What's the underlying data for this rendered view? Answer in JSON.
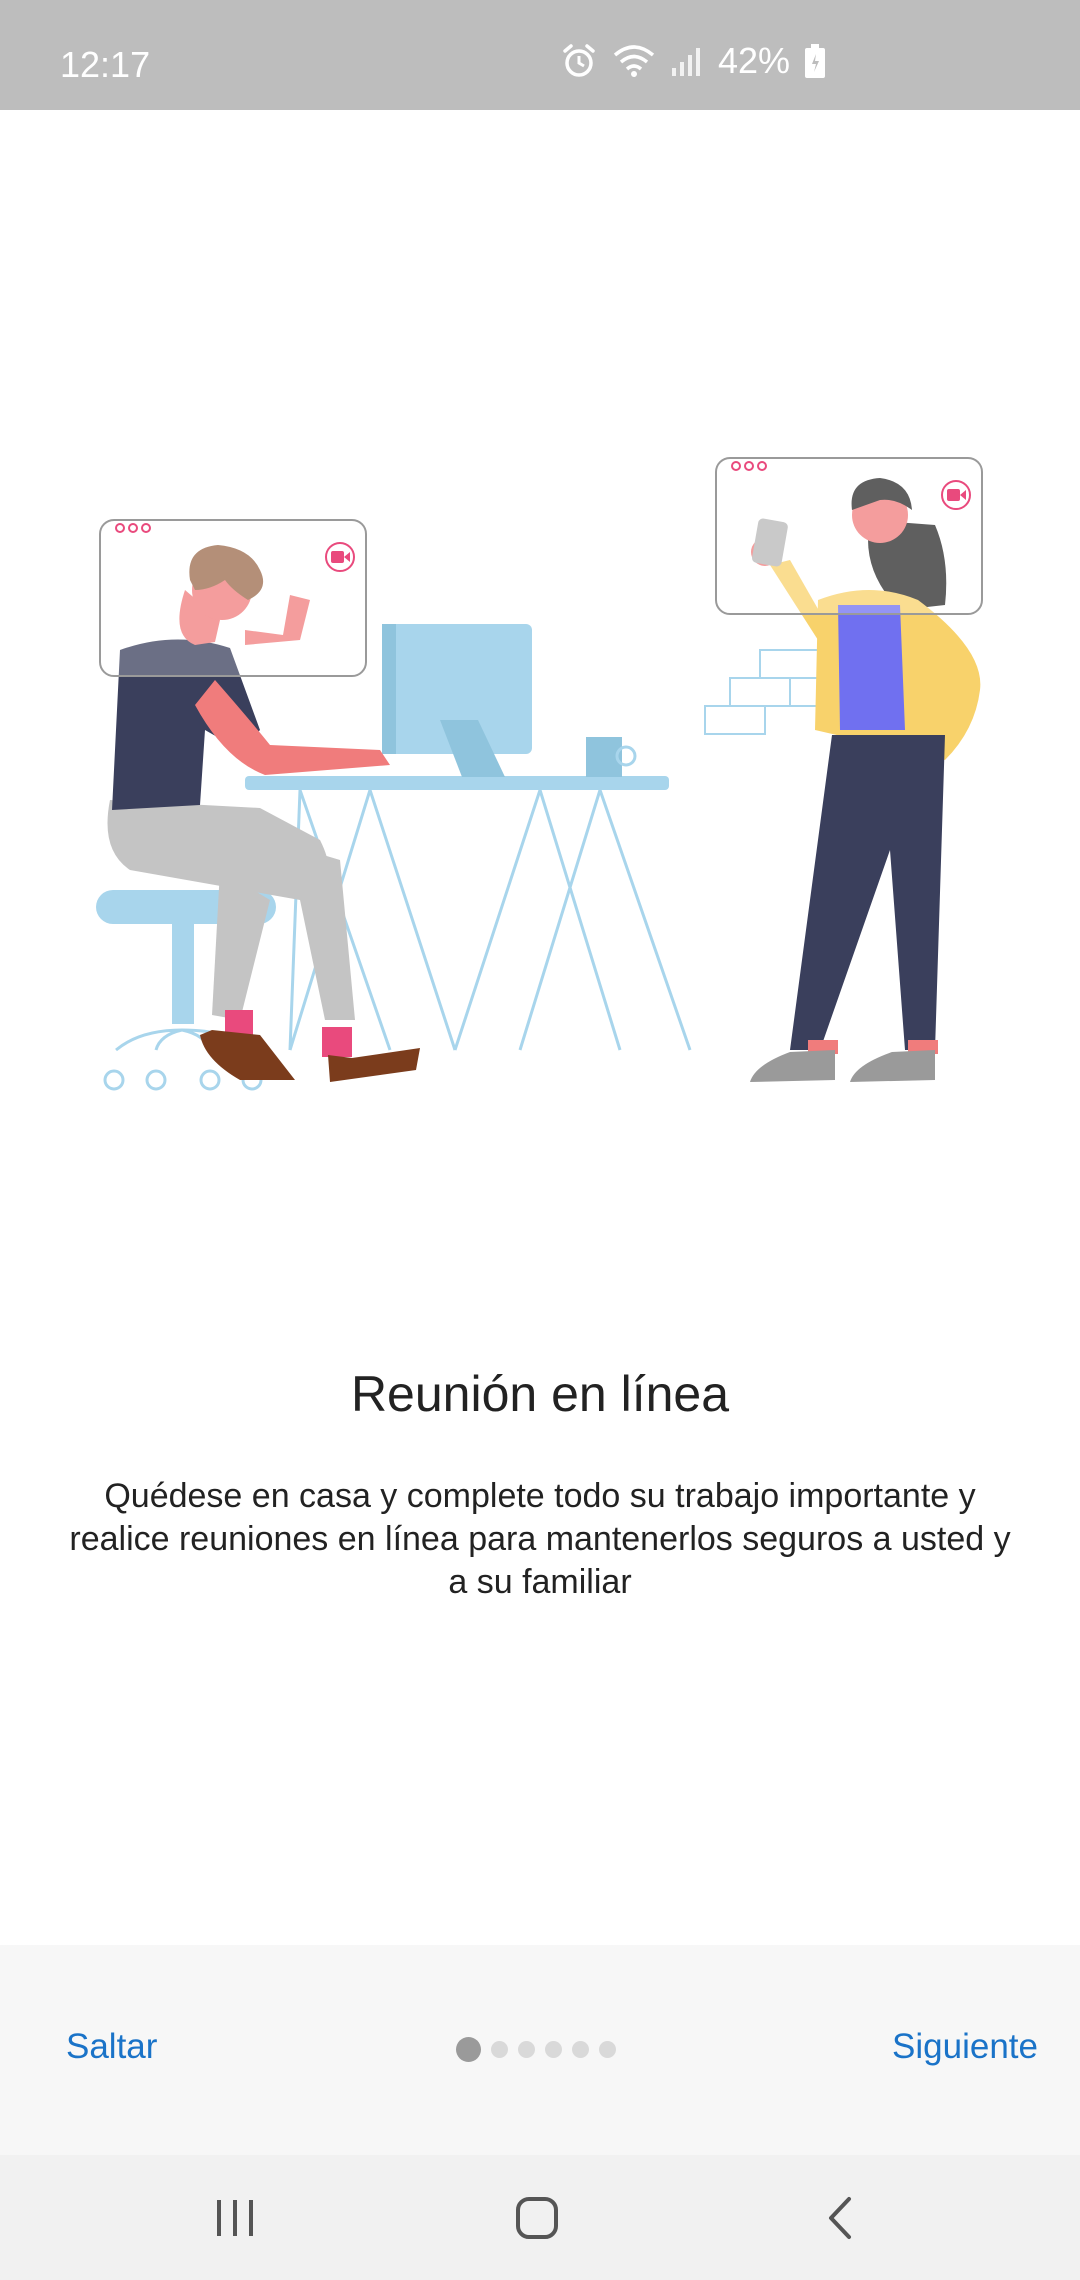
{
  "status_bar": {
    "time": "12:17",
    "battery": "42%",
    "icons": [
      "alarm-icon",
      "wifi-icon",
      "signal-icon",
      "battery-icon"
    ]
  },
  "onboarding": {
    "title": "Reunión en línea",
    "description": "Quédese en casa y complete todo su trabajo importante y realice reuniones en línea para mantenerlos seguros a usted y a su familiar",
    "page_indicator": {
      "current": 1,
      "total": 6
    }
  },
  "footer": {
    "skip_label": "Saltar",
    "next_label": "Siguiente"
  },
  "nav_bar": {
    "icons": [
      "recent-apps-icon",
      "home-icon",
      "back-icon"
    ]
  },
  "colors": {
    "accent": "#1a73c8",
    "status_bar": "#bdbdbd",
    "footer_bg": "#f7f7f7"
  }
}
